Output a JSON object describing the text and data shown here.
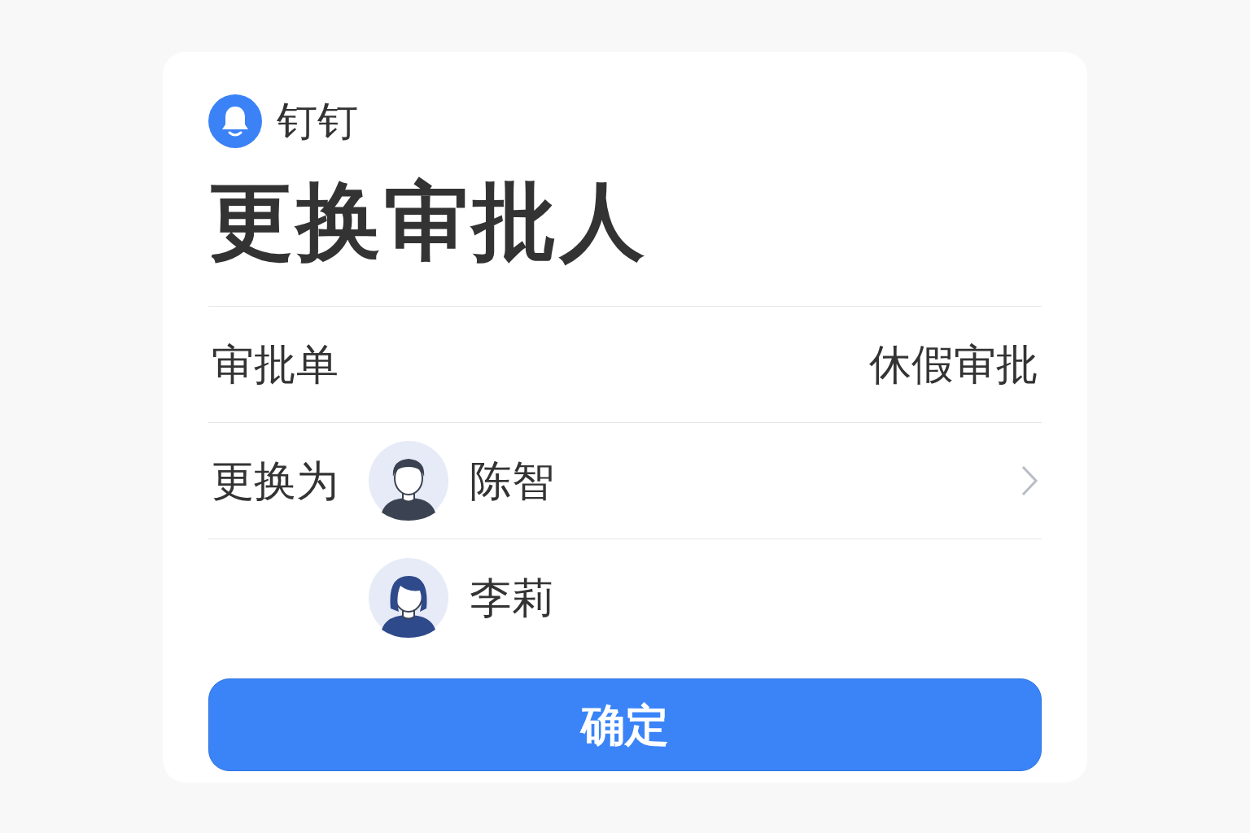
{
  "app": {
    "name": "钉钉"
  },
  "title": "更换审批人",
  "form": {
    "label": "审批单",
    "value": "休假审批"
  },
  "approvers": {
    "label": "更换为",
    "people": [
      {
        "name": "陈智",
        "kind": "male",
        "has_chevron": true
      },
      {
        "name": "李莉",
        "kind": "female",
        "has_chevron": false
      }
    ]
  },
  "confirm_button": "确定"
}
